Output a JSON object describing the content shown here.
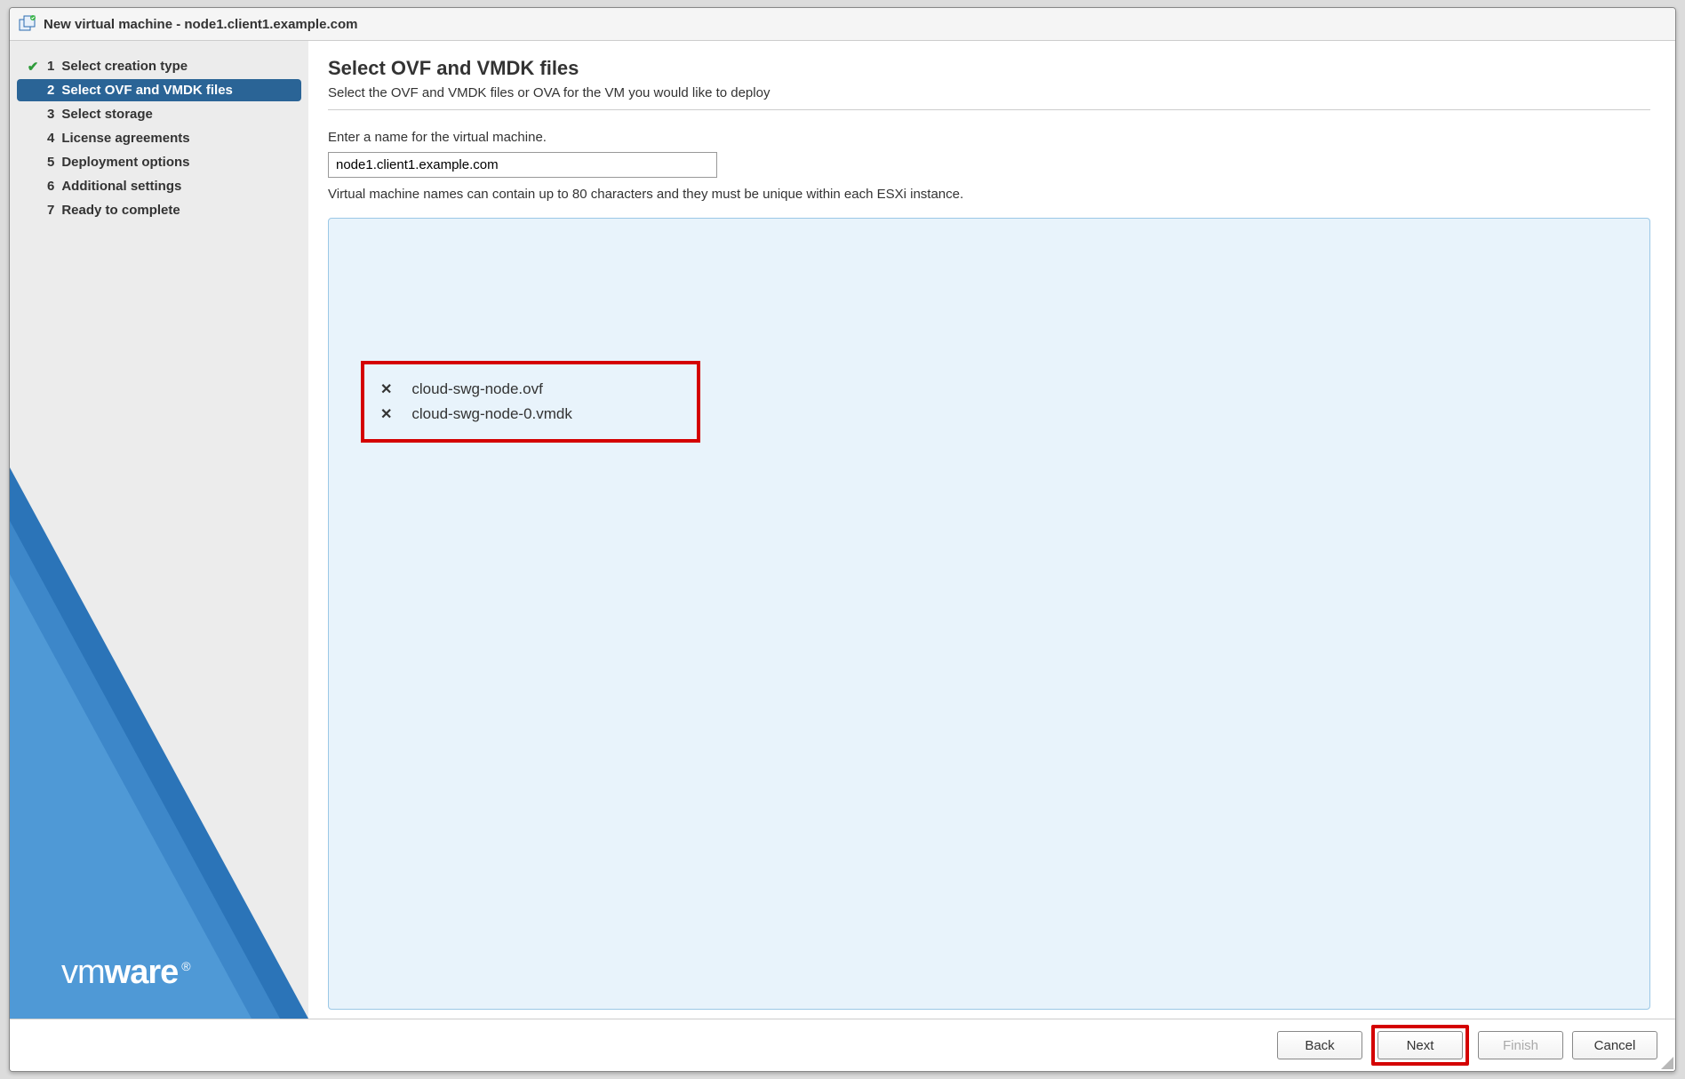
{
  "dialog": {
    "title": "New virtual machine - node1.client1.example.com"
  },
  "steps": [
    {
      "num": "1",
      "label": "Select creation type",
      "done": true
    },
    {
      "num": "2",
      "label": "Select OVF and VMDK files",
      "active": true
    },
    {
      "num": "3",
      "label": "Select storage"
    },
    {
      "num": "4",
      "label": "License agreements"
    },
    {
      "num": "5",
      "label": "Deployment options"
    },
    {
      "num": "6",
      "label": "Additional settings"
    },
    {
      "num": "7",
      "label": "Ready to complete"
    }
  ],
  "page": {
    "heading": "Select OVF and VMDK files",
    "subtitle": "Select the OVF and VMDK files or OVA for the VM you would like to deploy",
    "name_label": "Enter a name for the virtual machine.",
    "vm_name": "node1.client1.example.com",
    "name_hint": "Virtual machine names can contain up to 80 characters and they must be unique within each ESXi instance."
  },
  "files": [
    {
      "name": "cloud-swg-node.ovf"
    },
    {
      "name": "cloud-swg-node-0.vmdk"
    }
  ],
  "buttons": {
    "back": "Back",
    "next": "Next",
    "finish": "Finish",
    "cancel": "Cancel"
  },
  "brand": {
    "vm": "vm",
    "ware": "ware",
    "reg": "®"
  }
}
